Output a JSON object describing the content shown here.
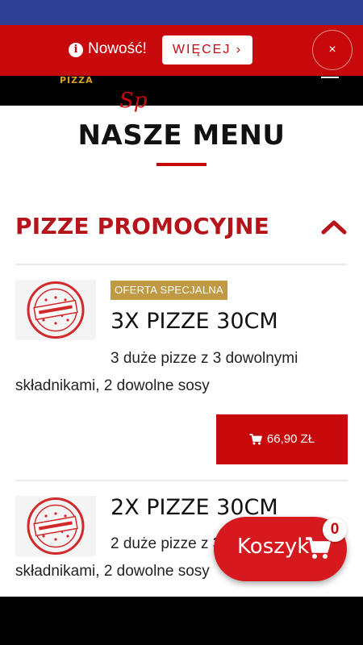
{
  "header": {
    "logo_text": "PIZZA",
    "script_text": "Sp"
  },
  "promo_bar": {
    "info_icon": "info-circle-icon",
    "text": "Nowość!",
    "more_label": "WIĘCEJ ›",
    "close_label": "×"
  },
  "page": {
    "title": "NASZE MENU"
  },
  "section": {
    "title": "PIZZE PROMOCYJNE",
    "toggle_icon": "chevron-up-icon"
  },
  "products": [
    {
      "badge": "OFERTA SPECJALNA",
      "name": "3X PIZZE 30CM",
      "description": "3 duże pizze z 3 dowolnymi składnikami, 2 dowolne sosy",
      "price": "66,90 ZŁ",
      "image_icon": "buy-now-stamp-icon"
    },
    {
      "name": "2X PIZZE 30CM",
      "description": "2 duże pizze z 3 dowolnymi składnikami, 2 dowolne sosy",
      "image_icon": "buy-now-stamp-icon"
    }
  ],
  "cart": {
    "label": "Koszyk",
    "count": "0",
    "icon": "cart-icon"
  },
  "colors": {
    "brand_red": "#c8090c",
    "section_red": "#b5141a",
    "badge_gold": "#c09945",
    "status_bar": "#2e3f94"
  }
}
